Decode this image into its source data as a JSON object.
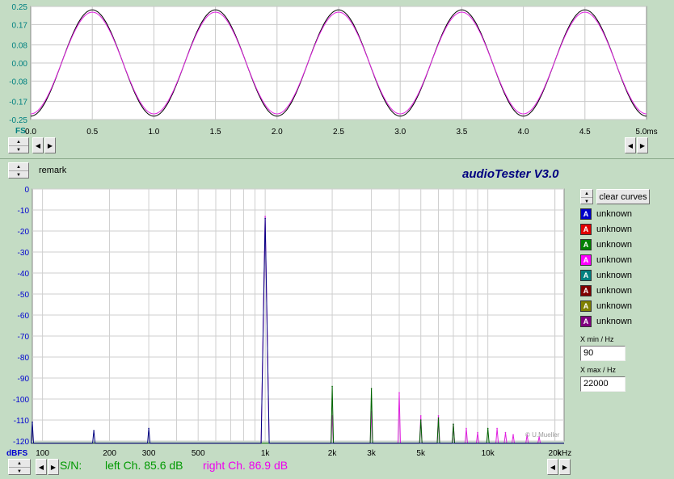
{
  "app": {
    "title": "audioTester  V3.0",
    "remark_label": "remark",
    "credit": "© U.Mueller"
  },
  "scope": {
    "x_unit": "ms",
    "y_corner_label": "FS",
    "y_ticks": [
      "0.25",
      "0.17",
      "0.08",
      "0.00",
      "-0.08",
      "-0.17",
      "-0.25"
    ],
    "x_ticks": [
      "0.0",
      "0.5",
      "1.0",
      "1.5",
      "2.0",
      "2.5",
      "3.0",
      "3.5",
      "4.0",
      "4.5",
      "5.0"
    ],
    "xlim": [
      0,
      5.0
    ],
    "ylim": [
      -0.25,
      0.25
    ]
  },
  "spectrum": {
    "y_unit": "dBFS",
    "x_unit": "kHz",
    "y_ticks": [
      "0",
      "-10",
      "-20",
      "-30",
      "-40",
      "-50",
      "-60",
      "-70",
      "-80",
      "-90",
      "-100",
      "-110",
      "-120"
    ],
    "x_ticks": [
      "100",
      "200",
      "300",
      "500",
      "1k",
      "2k",
      "3k",
      "5k",
      "10k",
      "20k"
    ],
    "xlim_hz": [
      90,
      22000
    ],
    "ylim_db": [
      -120,
      0
    ]
  },
  "colors": {
    "black_trace": "#000000",
    "magenta_trace": "#e020e0",
    "blue_trace": "#000080",
    "green_trace": "#006400",
    "axis_label": "#0000d0",
    "teal_label": "#008080",
    "title": "#000080"
  },
  "legend": {
    "clear_label": "clear curves",
    "items": [
      {
        "letter": "A",
        "label": "unknown",
        "color": "#0000c8"
      },
      {
        "letter": "A",
        "label": "unknown",
        "color": "#e00000"
      },
      {
        "letter": "A",
        "label": "unknown",
        "color": "#008000"
      },
      {
        "letter": "A",
        "label": "unknown",
        "color": "#ff00ff"
      },
      {
        "letter": "A",
        "label": "unknown",
        "color": "#008080"
      },
      {
        "letter": "A",
        "label": "unknown",
        "color": "#800000"
      },
      {
        "letter": "A",
        "label": "unknown",
        "color": "#808000"
      },
      {
        "letter": "A",
        "label": "unknown",
        "color": "#800080"
      }
    ]
  },
  "range": {
    "xmin_label": "X min / Hz",
    "xmin_value": "90",
    "xmax_label": "X max / Hz",
    "xmax_value": "22000"
  },
  "status": {
    "sn_label": "S/N:",
    "left": "left Ch. 85.6 dB",
    "right": "right Ch. 86.9 dB",
    "left_color": "#009900",
    "right_color": "#ee00ee"
  },
  "chart_data": [
    {
      "type": "line",
      "xlabel": "ms",
      "ylabel": "FS",
      "xlim": [
        0,
        5.0
      ],
      "ylim": [
        -0.25,
        0.25
      ],
      "grid": true,
      "series": [
        {
          "frequency_hz": 1000,
          "amplitude": 0.235,
          "color": "#000000"
        },
        {
          "frequency_hz": 1000,
          "amplitude": 0.225,
          "color": "#e020e0"
        }
      ]
    },
    {
      "type": "line",
      "xlabel": "kHz",
      "ylabel": "dBFS",
      "x_scale": "log",
      "xlim": [
        90,
        22000
      ],
      "ylim": [
        -120,
        0
      ],
      "grid": true,
      "series": [
        {
          "color": "#e020e0",
          "peaks": [
            {
              "x": 1000,
              "y": -13
            },
            {
              "x": 2000,
              "y": -108
            },
            {
              "x": 3000,
              "y": -106
            },
            {
              "x": 4000,
              "y": -97
            },
            {
              "x": 5000,
              "y": -108
            },
            {
              "x": 6000,
              "y": -108
            },
            {
              "x": 7000,
              "y": -112
            },
            {
              "x": 8000,
              "y": -114
            },
            {
              "x": 9000,
              "y": -116
            },
            {
              "x": 11000,
              "y": -114
            },
            {
              "x": 12000,
              "y": -116
            },
            {
              "x": 13000,
              "y": -117
            },
            {
              "x": 15000,
              "y": -117
            },
            {
              "x": 17000,
              "y": -118
            }
          ]
        },
        {
          "color": "#006400",
          "peaks": [
            {
              "x": 2000,
              "y": -94
            },
            {
              "x": 3000,
              "y": -95
            },
            {
              "x": 5000,
              "y": -110
            },
            {
              "x": 6000,
              "y": -109
            },
            {
              "x": 7000,
              "y": -112
            },
            {
              "x": 10000,
              "y": -114
            }
          ]
        },
        {
          "color": "#000080",
          "peaks": [
            {
              "x": 90,
              "y": -111
            },
            {
              "x": 170,
              "y": -115
            },
            {
              "x": 300,
              "y": -114
            },
            {
              "x": 1000,
              "y": -14
            }
          ]
        }
      ]
    }
  ]
}
